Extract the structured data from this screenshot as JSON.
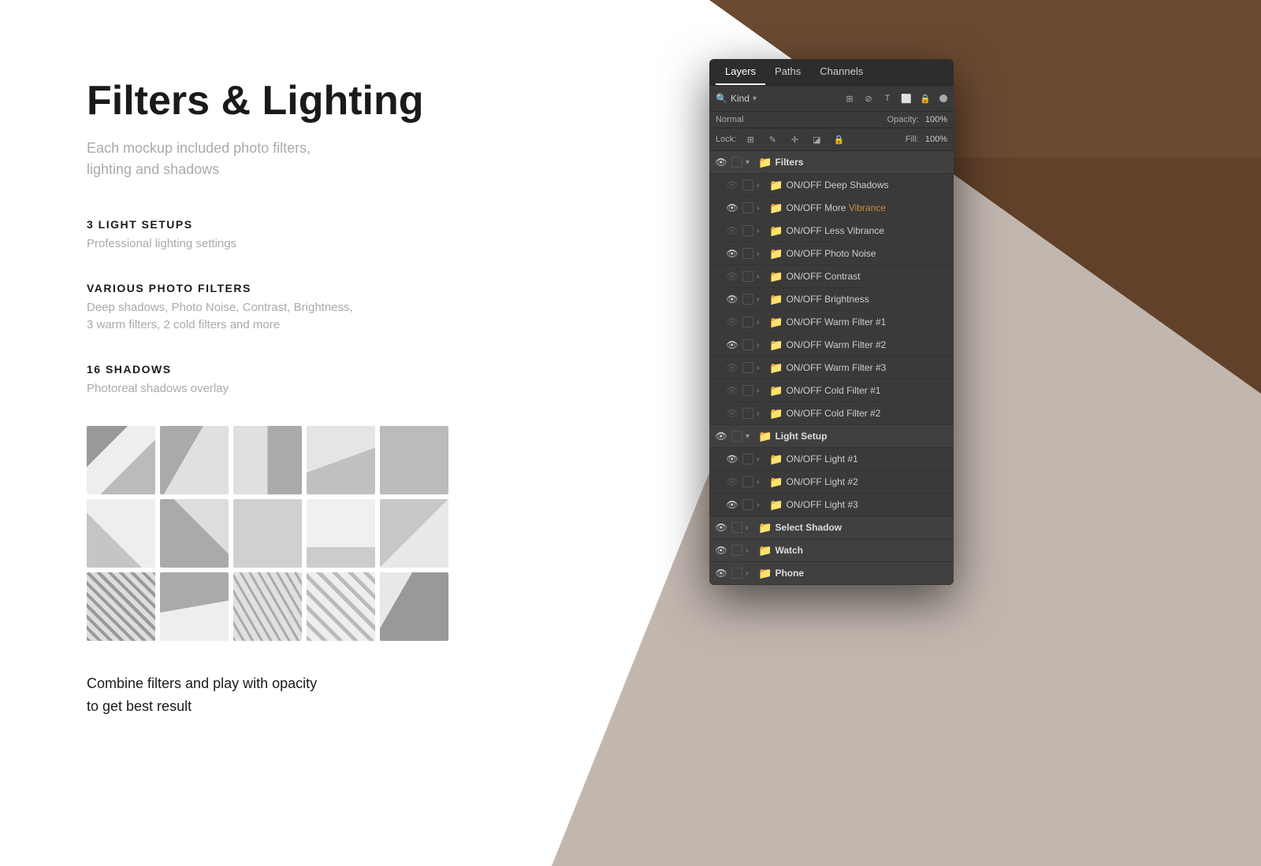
{
  "background": {
    "corner_color": "#6b4a32"
  },
  "left": {
    "title": "Filters & Lighting",
    "subtitle": "Each mockup included photo filters,\nlighting and shadows",
    "sections": [
      {
        "label": "3 Light Setups",
        "desc": "Professional lighting settings"
      },
      {
        "label": "Various Photo Filters",
        "desc": "Deep shadows, Photo Noise, Contrast, Brightness,\n3 warm filters, 2 cold filters and more"
      },
      {
        "label": "16 Shadows",
        "desc": "Photoreal shadows overlay"
      }
    ],
    "bottom_text": "Combine filters and play with opacity\nto get best result"
  },
  "photoshop": {
    "tabs": [
      "Layers",
      "Paths",
      "Channels"
    ],
    "active_tab": "Layers",
    "filter_label": "Kind",
    "opacity_label": "Opacity:",
    "opacity_value": "100%",
    "fill_label": "Fill:",
    "fill_value": "100%",
    "lock_label": "Lock:",
    "blend_mode": "Normal",
    "layer_groups": [
      {
        "name": "Filters",
        "visible": true,
        "expanded": true,
        "layers": [
          {
            "name": "ON/OFF Deep Shadows",
            "visible": false
          },
          {
            "name": "ON/OFF More Vibrance",
            "visible": true,
            "highlight": "Vibrance"
          },
          {
            "name": "ON/OFF Less Vibrance",
            "visible": false
          },
          {
            "name": "ON/OFF Photo Noise",
            "visible": true
          },
          {
            "name": "ON/OFF Contrast",
            "visible": false
          },
          {
            "name": "ON/OFF Brightness",
            "visible": true
          },
          {
            "name": "ON/OFF Warm Filter #1",
            "visible": false
          },
          {
            "name": "ON/OFF Warm Filter #2",
            "visible": true
          },
          {
            "name": "ON/OFF Warm Filter #3",
            "visible": false
          },
          {
            "name": "ON/OFF Cold Filter #1",
            "visible": false
          },
          {
            "name": "ON/OFF Cold Filter #2",
            "visible": false
          }
        ]
      },
      {
        "name": "Light Setup",
        "visible": true,
        "expanded": true,
        "layers": [
          {
            "name": "ON/OFF Light #1",
            "visible": true
          },
          {
            "name": "ON/OFF Light #2",
            "visible": false
          },
          {
            "name": "ON/OFF Light #3",
            "visible": true
          }
        ]
      },
      {
        "name": "Select Shadow",
        "visible": true,
        "expanded": false,
        "layers": []
      },
      {
        "name": "Watch",
        "visible": true,
        "expanded": false,
        "layers": []
      },
      {
        "name": "Phone",
        "visible": true,
        "expanded": false,
        "layers": []
      }
    ]
  }
}
